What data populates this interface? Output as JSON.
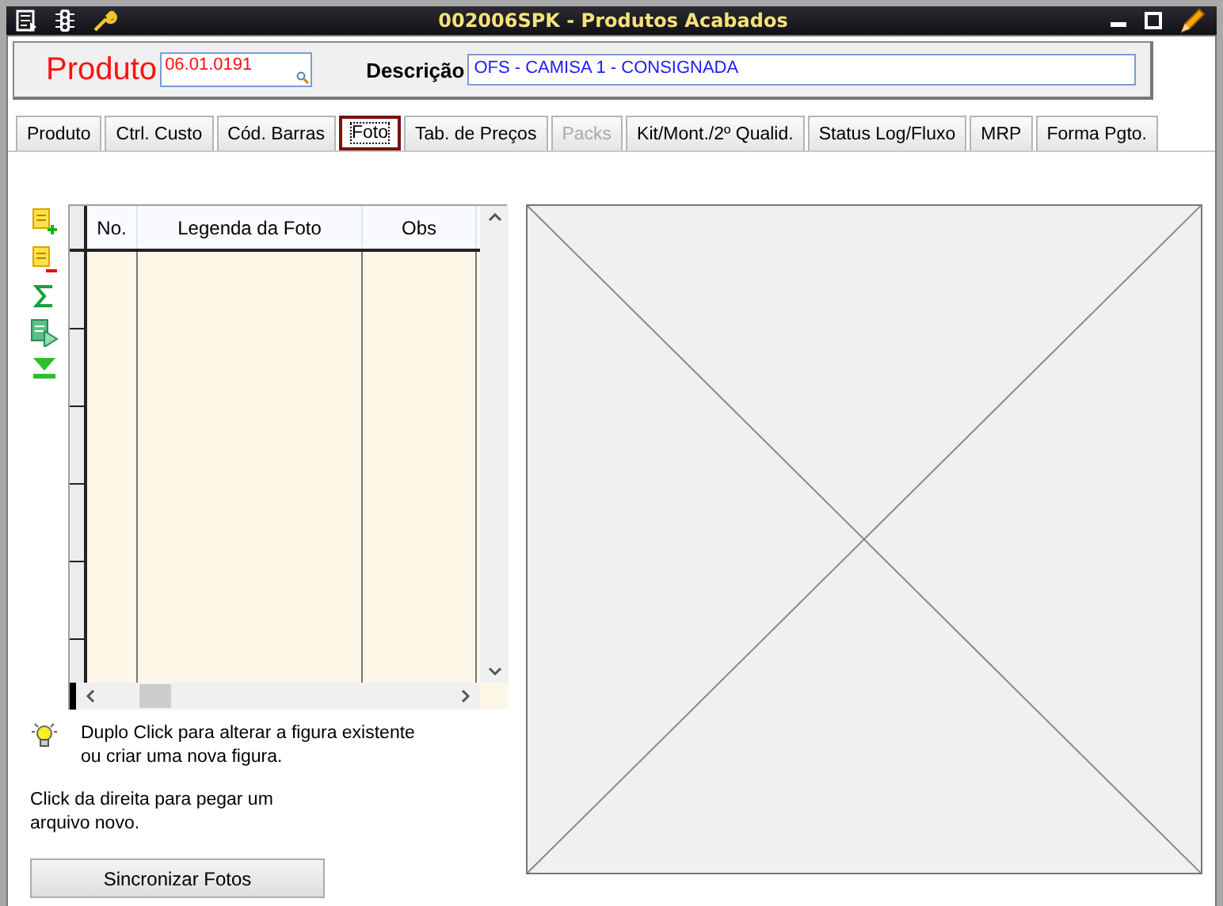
{
  "window": {
    "title": "002006SPK - Produtos Acabados"
  },
  "product": {
    "label": "Produto",
    "value": "06.01.0191"
  },
  "description": {
    "label": "Descrição",
    "value": "OFS - CAMISA 1 - CONSIGNADA"
  },
  "tabs": [
    {
      "label": "Produto",
      "selected": false,
      "disabled": false
    },
    {
      "label": "Ctrl. Custo",
      "selected": false,
      "disabled": false
    },
    {
      "label": "Cód. Barras",
      "selected": false,
      "disabled": false
    },
    {
      "label": "Foto",
      "selected": true,
      "disabled": false
    },
    {
      "label": "Tab. de Preços",
      "selected": false,
      "disabled": false
    },
    {
      "label": "Packs",
      "selected": false,
      "disabled": true
    },
    {
      "label": "Kit/Mont./2º Qualid.",
      "selected": false,
      "disabled": false
    },
    {
      "label": "Status Log/Fluxo",
      "selected": false,
      "disabled": false
    },
    {
      "label": "MRP",
      "selected": false,
      "disabled": false
    },
    {
      "label": "Forma Pgto.",
      "selected": false,
      "disabled": false
    }
  ],
  "photo_grid": {
    "columns": [
      "No.",
      "Legenda da Foto",
      "Obs"
    ]
  },
  "hints": [
    "Duplo Click para alterar a figura existente ou criar uma nova figura.",
    "Click da direita para pegar um arquivo novo."
  ],
  "sync_button": "Sincronizar Fotos"
}
